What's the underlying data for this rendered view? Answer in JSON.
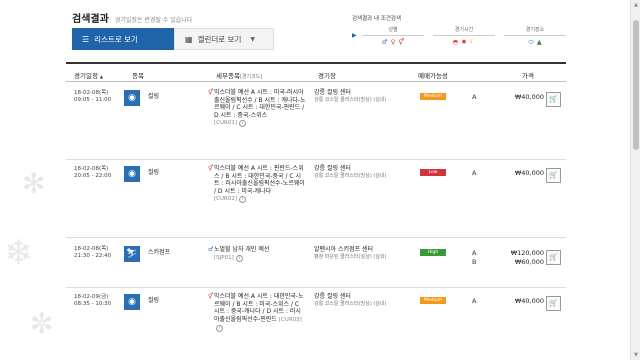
{
  "header": {
    "title": "검색결과",
    "note": "경기일정은 변경될 수 있습니다",
    "list_view_label": "리스트로 보기",
    "calendar_view_label": "캘린더로 보기"
  },
  "filter": {
    "title": "검색결과 내 조건검색",
    "columns": [
      {
        "label": "성별",
        "icons": [
          "male-icon",
          "female-icon",
          "mixed-icon"
        ]
      },
      {
        "label": "경기시간",
        "icons": [
          "morning-icon",
          "sun-icon",
          "moon-icon"
        ]
      },
      {
        "label": "경기장소",
        "icons": [
          "stadium-icon",
          "mountain-icon"
        ]
      }
    ]
  },
  "table": {
    "headers": {
      "date": "경기일정",
      "sport": "종목",
      "detail": "세부종목",
      "detail_sub": "[경기코드]",
      "venue": "경기장",
      "availability": "예매가능성",
      "price": "가격"
    },
    "rows": [
      {
        "date": "18-02-08(목)",
        "time": "09:05 - 11:00",
        "sport": "컬링",
        "sport_icon": "curling-icon",
        "detail": "믹스더블 예선 A 시트 : 미국-러시아출신올림픽선수 / B 시트 : 캐나다-노르웨이 / C 시트 : 대한민국-핀란드 / D 시트 : 중국-스위스",
        "code": "[CUR01]",
        "venue": "강릉 컬링 센터",
        "venue_sub": "강릉 코스탈 클러스터(빙상) (실내)",
        "availability": "Medium",
        "availability_color": "#f39a1e",
        "grades": [
          "A"
        ],
        "prices": [
          "₩40,000"
        ]
      },
      {
        "date": "18-02-08(목)",
        "time": "20:05 - 22:00",
        "sport": "컬링",
        "sport_icon": "curling-icon",
        "detail": "믹스더블 예선 A 시트 : 핀란드-스위스 / B 시트 : 대한민국-중국 / C 시트 : 러시아출신올림픽선수-노르웨이 / D 시트 : 미국-캐나다",
        "code": "[CUR02]",
        "venue": "강릉 컬링 센터",
        "venue_sub": "강릉 코스탈 클러스터(빙상) (실내)",
        "availability": "Low",
        "availability_color": "#d0343f",
        "grades": [
          "A"
        ],
        "prices": [
          "₩40,000"
        ]
      },
      {
        "date": "18-02-08(목)",
        "time": "21:30 - 22:40",
        "sport": "스키점프",
        "sport_icon": "ski-jump-icon",
        "detail": "노멀힐 남자 개인 예선",
        "code": "[SJP01]",
        "venue": "알펜시아 스키점프 센터",
        "venue_sub": "평창 마운틴 클러스터(설상) (실외)",
        "availability": "High",
        "availability_color": "#3a9a3a",
        "grades": [
          "A",
          "B"
        ],
        "prices": [
          "₩120,000",
          "₩60,000"
        ]
      },
      {
        "date": "18-02-09(금)",
        "time": "08:35 - 10:30",
        "sport": "컬링",
        "sport_icon": "curling-icon",
        "detail": "믹스더블 예선 A 시트 : 대한민국-노르웨이 / B 시트 : 미국-스위스 / C 시트 : 중국-캐나다 / D 시트 : 러시아출신올림픽선수-핀란드",
        "code": "[CUR03]",
        "venue": "강릉 컬링 센터",
        "venue_sub": "강릉 코스탈 클러스터(빙상) (실내)",
        "availability": "Medium",
        "availability_color": "#f39a1e",
        "grades": [
          "A"
        ],
        "prices": [
          "₩40,000"
        ]
      }
    ]
  }
}
